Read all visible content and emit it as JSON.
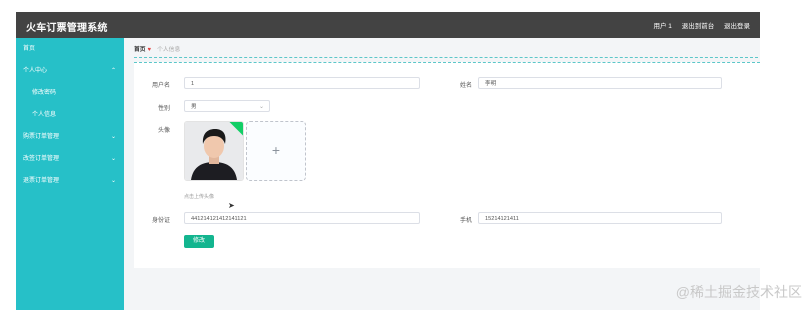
{
  "header": {
    "title": "火车订票管理系统",
    "nav": [
      "用户 1",
      "退出到前台",
      "退出登录"
    ]
  },
  "sidebar": {
    "items": [
      {
        "label": "首页",
        "has_children": false
      },
      {
        "label": "个人中心",
        "has_children": true
      },
      {
        "label": "修改密码",
        "sub": true
      },
      {
        "label": "个人信息",
        "sub": true
      },
      {
        "label": "购票订单管理",
        "has_children": true
      },
      {
        "label": "改签订单管理",
        "has_children": true
      },
      {
        "label": "退票订单管理",
        "has_children": true
      }
    ],
    "color": "#26c0c8"
  },
  "breadcrumb": {
    "home": "首页",
    "heart": "♥",
    "current": "个人信息"
  },
  "form": {
    "username_label": "用户名",
    "username_value": "1",
    "name_label": "姓名",
    "name_value": "李明",
    "gender_label": "性别",
    "gender_value": "男",
    "avatar_label": "头像",
    "upload_plus": "+",
    "upload_hint": "点击上传头像",
    "idcard_label": "身份证",
    "idcard_value": "441214121412141121",
    "phone_label": "手机",
    "phone_value": "15214121411",
    "submit_label": "修改"
  },
  "watermark": "@稀土掘金技术社区",
  "colors": {
    "topbar": "#434343",
    "accent": "#26c0c8",
    "button": "#13b58f"
  }
}
